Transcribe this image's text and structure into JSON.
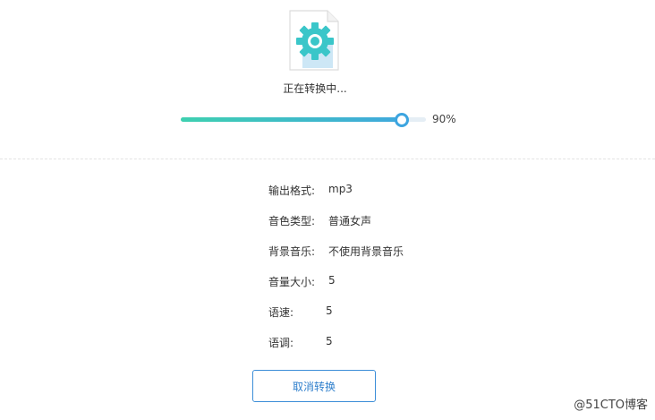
{
  "conversion": {
    "status": "正在转换中...",
    "progress_fraction": 0.9,
    "progress_label": "90%"
  },
  "settings": [
    {
      "label": "输出格式:",
      "value": "mp3"
    },
    {
      "label": "音色类型:",
      "value": "普通女声"
    },
    {
      "label": "背景音乐:",
      "value": "不使用背景音乐"
    },
    {
      "label": "音量大小:",
      "value": "5"
    },
    {
      "label": "语速:",
      "value": "5"
    },
    {
      "label": "语调:",
      "value": "5"
    }
  ],
  "actions": {
    "cancel_label": "取消转换"
  },
  "watermark": "@51CTO博客",
  "colors": {
    "accent_start": "#3ed0b0",
    "accent_end": "#3fa8dd",
    "button_border": "#3c8ed8"
  },
  "icons": {
    "file": "file-gear-icon"
  }
}
